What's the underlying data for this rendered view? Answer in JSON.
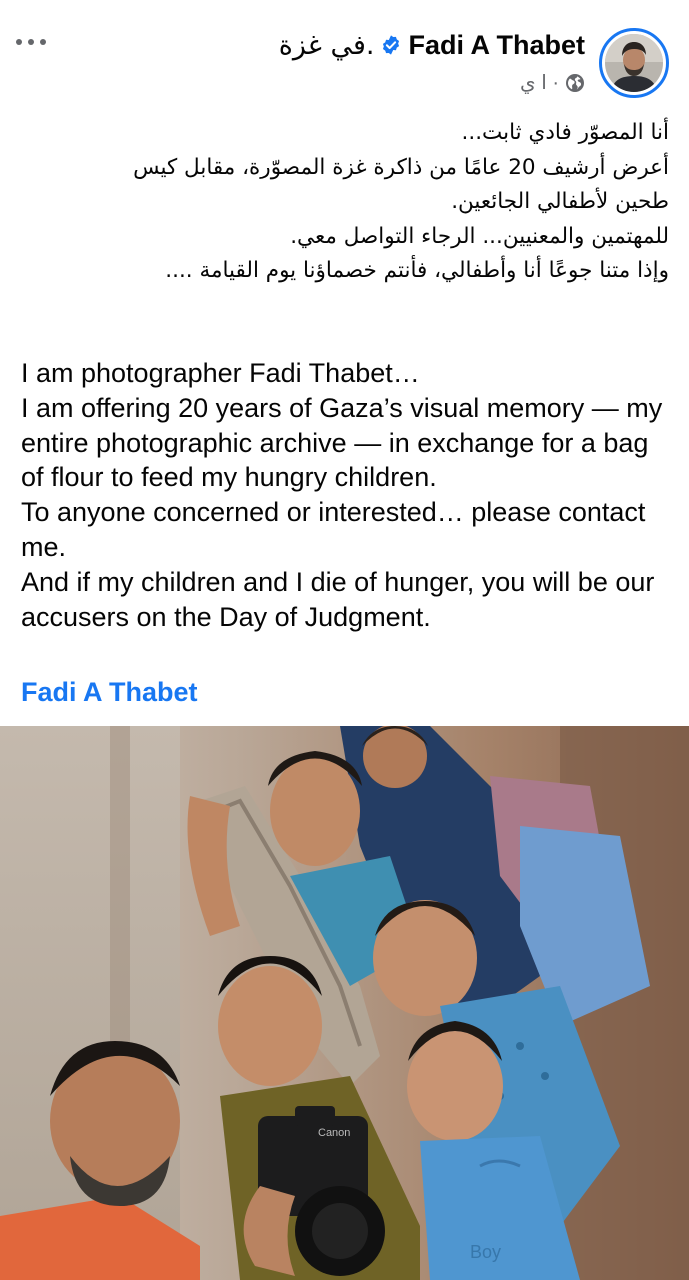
{
  "header": {
    "author_name": "Fadi A Thabet",
    "location": "في غزة.",
    "time": "ا ي ·",
    "avatar_icon": "profile-photo",
    "verified_icon": "verified-badge-icon",
    "privacy_icon": "globe-icon",
    "more_icon": "more-options-icon"
  },
  "post": {
    "arabic_lines": [
      "أنا المصوّر فادي ثابت...",
      "أعرض أرشيف 20 عامًا من ذاكرة غزة المصوّرة، مقابل كيس",
      "طحين لأطفالي الجائعين.",
      "للمهتمين والمعنيين... الرجاء التواصل معي.",
      "وإذا متنا جوعًا أنا وأطفالي، فأنتم خصماؤنا يوم القيامة ...."
    ],
    "english_lines": [
      "I am photographer Fadi Thabet…",
      "I am offering 20 years of Gaza’s visual memory — my entire photographic archive — in exchange for a bag of flour to feed my hungry children.",
      "To anyone concerned or interested… please contact me.",
      "And if my children and I die of hunger, you will be our accusers on the Day of Judgment."
    ],
    "author_link": "Fadi A Thabet"
  },
  "photo": {
    "camera_brand": "Canon",
    "shirt_text": "Boy"
  },
  "colors": {
    "accent": "#1877f2",
    "text": "#050505",
    "secondary": "#65676b"
  }
}
